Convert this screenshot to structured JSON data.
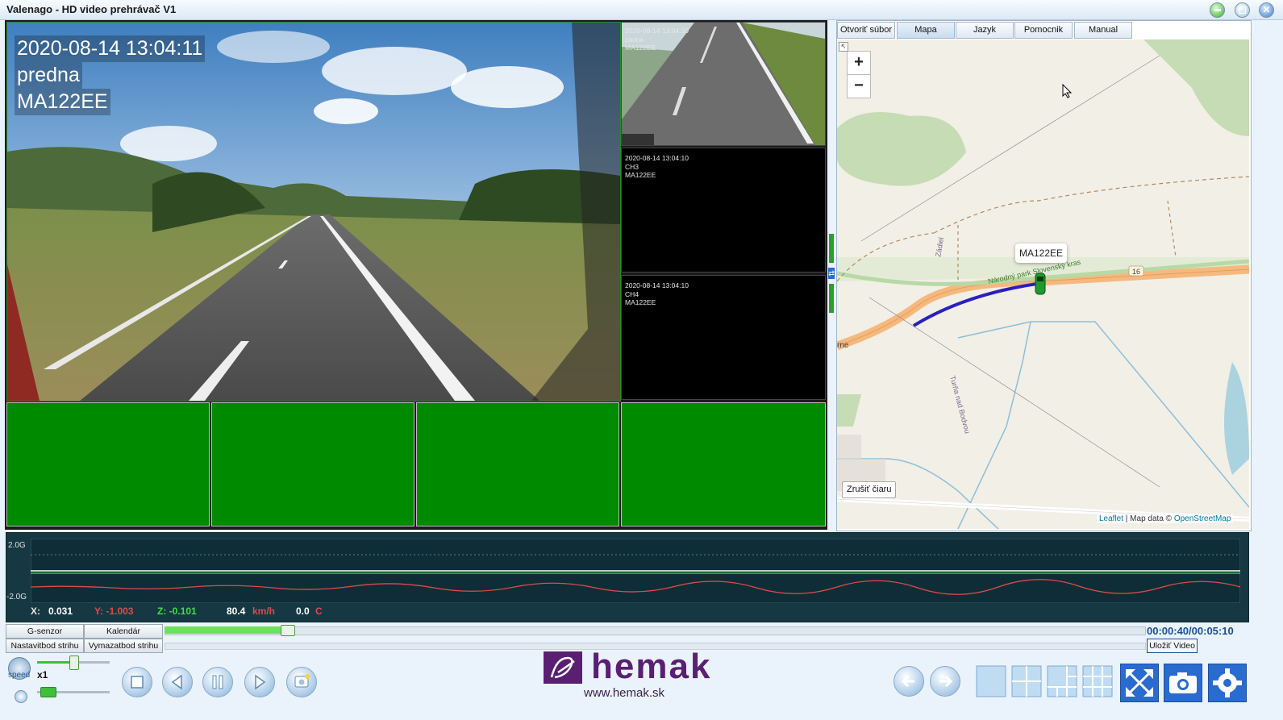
{
  "window": {
    "title": "Valenago - HD video prehrávač V1"
  },
  "main_video": {
    "timestamp": "2020-08-14 13:04:11",
    "channel": "predna",
    "plate": "MA122EE"
  },
  "side_cameras": [
    {
      "timestamp": "2020-08-14 13:04:10",
      "channel": "zadna",
      "plate": "MA122EE"
    },
    {
      "timestamp": "2020-08-14 13:04:10",
      "channel": "CH3",
      "plate": "MA122EE"
    },
    {
      "timestamp": "2020-08-14 13:04:10",
      "channel": "CH4",
      "plate": "MA122EE"
    }
  ],
  "map_tabs": [
    "Otvoriť súbor",
    "Mapa",
    "Jazyk",
    "Pomocnik",
    "Manual"
  ],
  "map": {
    "zoom_in": "+",
    "zoom_out": "−",
    "marker_label": "MA122EE",
    "clear_line": "Zrušiť čiaru",
    "road_number": "16",
    "labels": {
      "park": "Národný park Slovenský kras",
      "street1": "Zádiel",
      "street2": "Turňa nad Bodvou",
      "edge": "rne"
    },
    "attribution": {
      "leaflet": "Leaflet",
      "sep": " | Map data © ",
      "osm": "OpenStreetMap"
    }
  },
  "gsensor": {
    "scale_top": "2.0G",
    "scale_bottom": "-2.0G",
    "x_label": "X:",
    "x_value": "0.031",
    "y_label": "Y: -1.003",
    "z_label": "Z: -0.101",
    "speed": "80.4",
    "speed_unit": "km/h",
    "temp": "0.0",
    "temp_unit": "C"
  },
  "controls": {
    "gsensor_btn": "G-senzor",
    "calendar_btn": "Kalendár",
    "set_cut_btn": "Nastavitbod strihu",
    "delete_cut_btn": "Vymazatbod strihu",
    "speed_label": "speed",
    "speed_value": "x1",
    "timecode": "00:00:40/00:05:10",
    "save_video": "Uložiť Video",
    "progress": 0.13
  },
  "brand": {
    "name": "hemak",
    "url": "www.hemak.sk"
  },
  "colors": {
    "accent_green": "#008a00",
    "gsensor_bg": "#163842",
    "brand_purple": "#5a1f72",
    "route_blue": "#2a1fc0"
  }
}
